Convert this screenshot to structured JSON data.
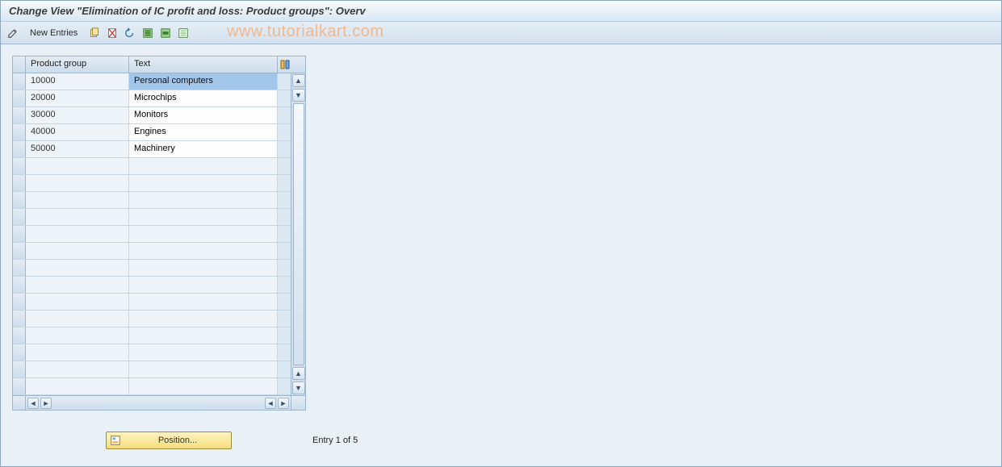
{
  "title": "Change View \"Elimination of IC profit and loss: Product groups\": Overv",
  "watermark": "www.tutorialkart.com",
  "toolbar": {
    "new_entries_label": "New Entries"
  },
  "grid": {
    "columns": {
      "product_group": "Product group",
      "text": "Text"
    },
    "rows": [
      {
        "pg": "10000",
        "tx": "Personal computers",
        "selected": true
      },
      {
        "pg": "20000",
        "tx": "Microchips"
      },
      {
        "pg": "30000",
        "tx": "Monitors"
      },
      {
        "pg": "40000",
        "tx": "Engines"
      },
      {
        "pg": "50000",
        "tx": "Machinery"
      }
    ],
    "empty_rows": 14
  },
  "footer": {
    "position_label": "Position...",
    "entry_text": "Entry 1 of 5"
  }
}
